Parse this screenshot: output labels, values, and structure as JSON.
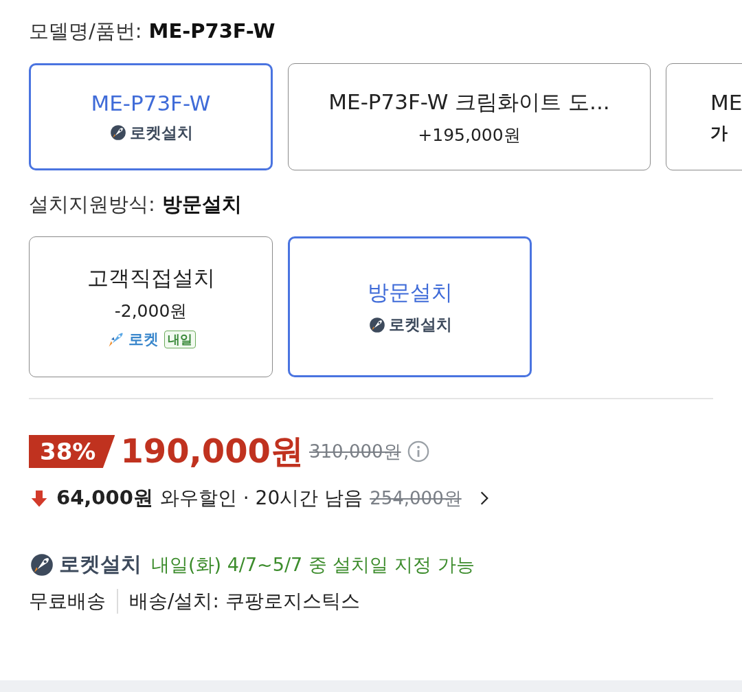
{
  "model_option": {
    "label": "모델명/품번:",
    "value": "ME-P73F-W",
    "options": [
      {
        "name": "ME-P73F-W",
        "selected": true,
        "badge": {
          "kind": "rocket_install",
          "text": "로켓설치"
        }
      },
      {
        "name": "ME-P73F-W 크림화이트 도...",
        "selected": false,
        "price": "+195,000원"
      },
      {
        "name": "ME",
        "selected": false,
        "price": "가"
      }
    ]
  },
  "install_option": {
    "label": "설치지원방식:",
    "value": "방문설치",
    "options": [
      {
        "name": "고객직접설치",
        "selected": false,
        "price": "-2,000원",
        "badge": {
          "kind": "rocket",
          "text": "로켓",
          "tag": "내일"
        }
      },
      {
        "name": "방문설치",
        "selected": true,
        "badge": {
          "kind": "rocket_install",
          "text": "로켓설치"
        }
      }
    ]
  },
  "price": {
    "discount": "38%",
    "sale": "190,000원",
    "original": "310,000원"
  },
  "wow": {
    "amount": "64,000원",
    "label": "와우할인 · 20시간 남음",
    "original": "254,000원"
  },
  "delivery": {
    "badge": "로켓설치",
    "message": "내일(화) 4/7~5/7 중 설치일 지정 가능",
    "shipping": "무료배송",
    "carrier": "배송/설치: 쿠팡로지스틱스"
  }
}
